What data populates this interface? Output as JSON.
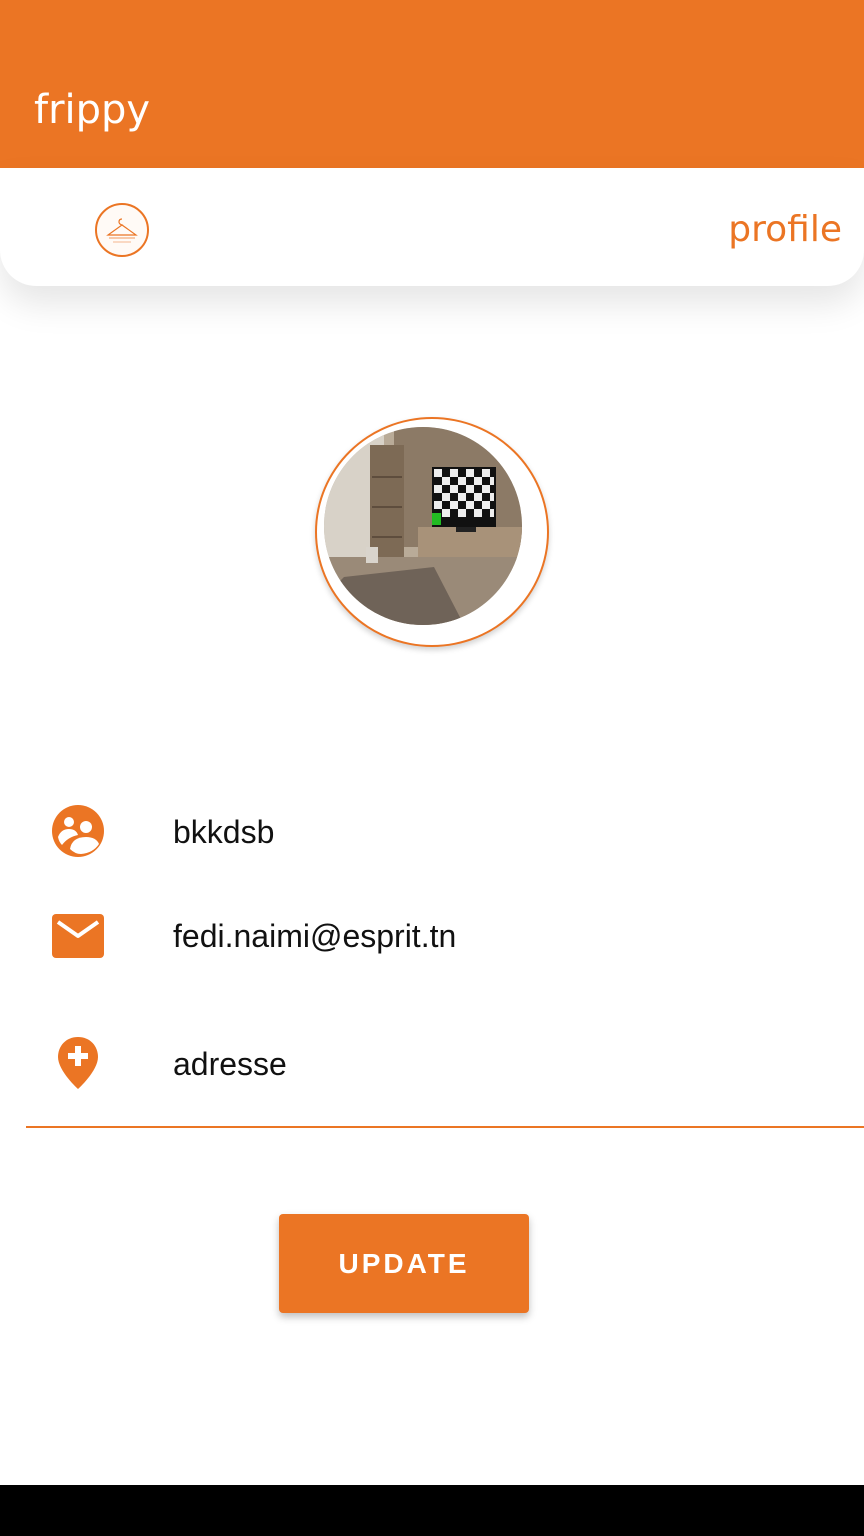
{
  "app_bar": {
    "title": "frippy"
  },
  "header": {
    "logo": "frippy-hanger-logo",
    "tab_label": "profile"
  },
  "profile": {
    "avatar": "profile-photo",
    "fields": [
      {
        "icon": "group-icon",
        "value": "bkkdsb"
      },
      {
        "icon": "mail-icon",
        "value": "fedi.naimi@esprit.tn"
      },
      {
        "icon": "add-location-icon",
        "value": "adresse"
      }
    ]
  },
  "actions": {
    "update_label": "UPDATE"
  },
  "colors": {
    "accent": "#EB7524",
    "text": "#111111",
    "background": "#FFFFFF",
    "nav_bar": "#000000"
  }
}
